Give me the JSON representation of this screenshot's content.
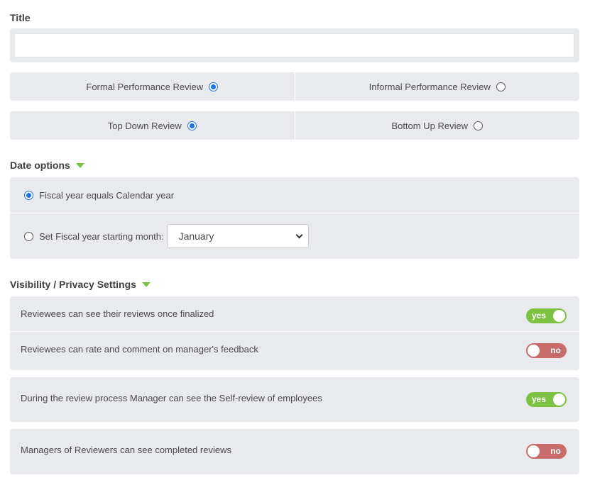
{
  "title_section": {
    "label": "Title",
    "value": "",
    "placeholder": ""
  },
  "review_type": {
    "options": [
      {
        "label": "Formal Performance Review",
        "selected": true
      },
      {
        "label": "Informal Performance Review",
        "selected": false
      }
    ]
  },
  "review_direction": {
    "options": [
      {
        "label": "Top Down Review",
        "selected": true
      },
      {
        "label": "Bottom Up Review",
        "selected": false
      }
    ]
  },
  "date_options": {
    "label": "Date options",
    "fiscal_calendar_label": "Fiscal year equals Calendar year",
    "fiscal_month_label": "Set Fiscal year starting month:",
    "selected_month": "January"
  },
  "visibility": {
    "label": "Visibility / Privacy Settings",
    "settings": [
      {
        "text": "Reviewees can see their reviews once finalized",
        "value": "yes"
      },
      {
        "text": "Reviewees can rate and comment on manager's feedback",
        "value": "no"
      },
      {
        "text": "During the review process Manager can see the Self-review of employees",
        "value": "yes"
      },
      {
        "text": "Managers of Reviewers can see completed reviews",
        "value": "no"
      }
    ]
  },
  "colors": {
    "toggle_on": "#7cc142",
    "toggle_off": "#c86b6b",
    "radio_selected": "#1a73e8",
    "panel_bg": "#e9eaee"
  }
}
